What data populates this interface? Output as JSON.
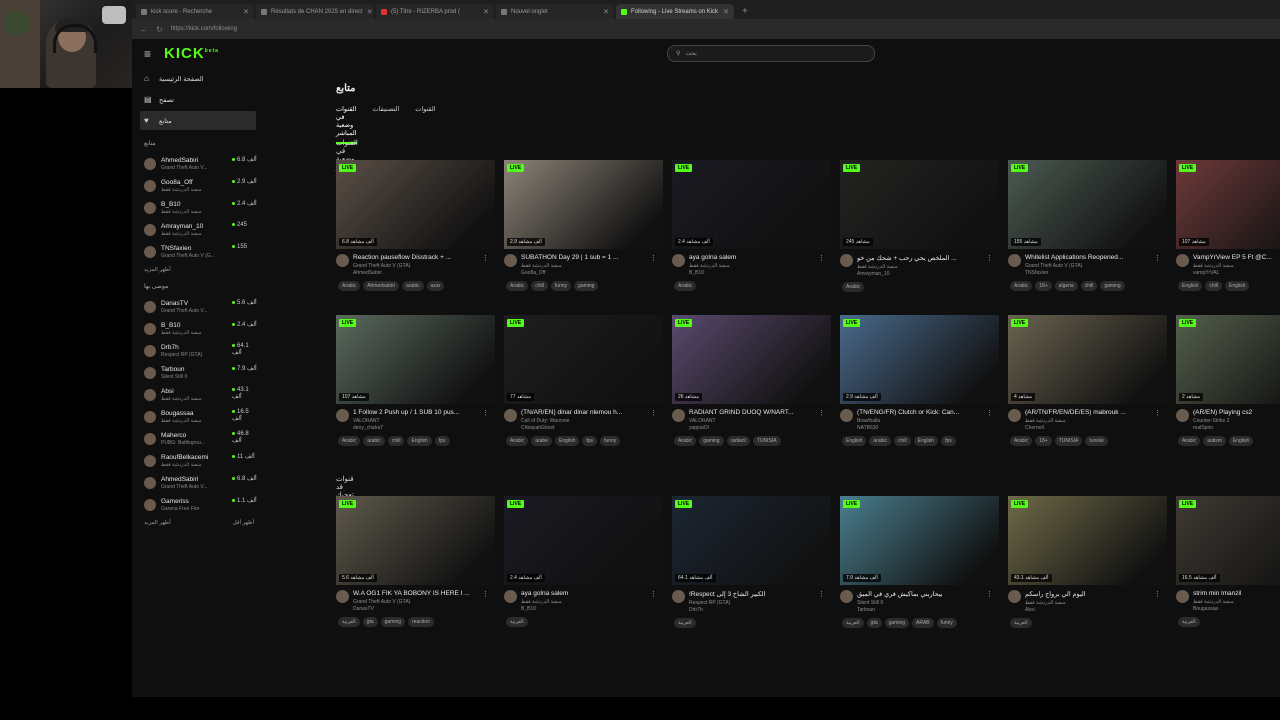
{
  "tabs": [
    {
      "label": "kick score - Recherche",
      "active": false
    },
    {
      "label": "Résultats de CHAN 2025 en direct",
      "active": false
    },
    {
      "label": "(5) Titre - RIZERBA prod (",
      "active": false
    },
    {
      "label": "Nouvel onglet",
      "active": false
    },
    {
      "label": "Following - Live Streams on Kick",
      "active": true
    }
  ],
  "address": {
    "url": "https://kick.com/following"
  },
  "header": {
    "logo": "KICK",
    "logo_sup": "beta",
    "search_placeholder": "بحث"
  },
  "sidebar": {
    "nav": [
      {
        "label": "الصفحة الرئيسية",
        "icon": "home-icon"
      },
      {
        "label": "تصفح",
        "icon": "browse-icon"
      },
      {
        "label": "متابع",
        "icon": "heart-icon"
      }
    ],
    "following_title": "متابع",
    "following": [
      {
        "name": "AhmedSabiri",
        "game": "Grand Theft Auto V...",
        "viewers": "6.8 ألف"
      },
      {
        "name": "Goo8a_Off",
        "game": "منصة الدردشة فقط",
        "viewers": "2.9 ألف"
      },
      {
        "name": "B_B10",
        "game": "منصة الدردشة فقط",
        "viewers": "2.4 ألف"
      },
      {
        "name": "Amrayman_10",
        "game": "منصة الدردشة فقط",
        "viewers": "245"
      },
      {
        "name": "TNSfaxien",
        "game": "Grand Theft Auto V (G...",
        "viewers": "155"
      }
    ],
    "show_more": "أظهر المزيد",
    "recommended_title": "موصى بها",
    "recommended": [
      {
        "name": "DanasTV",
        "game": "Grand Theft Auto V...",
        "viewers": "5.6 ألف"
      },
      {
        "name": "B_B10",
        "game": "منصة الدردشة فقط",
        "viewers": "2.4 ألف"
      },
      {
        "name": "Drb7h",
        "game": "Respect RP (GTA)",
        "viewers": "64.1 ألف"
      },
      {
        "name": "Tarboun",
        "game": "Silent Still II",
        "viewers": "7.9 ألف"
      },
      {
        "name": "Absi",
        "game": "منصة الدردشة فقط",
        "viewers": "43.1 ألف"
      },
      {
        "name": "Bougassaa",
        "game": "منصة الدردشة فقط",
        "viewers": "16.5 ألف"
      },
      {
        "name": "Maherco",
        "game": "PUBG: Battlegrou...",
        "viewers": "46.8 ألف"
      },
      {
        "name": "RaoufBelkacemi",
        "game": "منصة الدردشة فقط",
        "viewers": "11 ألف"
      },
      {
        "name": "AhmedSabiri",
        "game": "Grand Theft Auto V...",
        "viewers": "6.8 ألف"
      },
      {
        "name": "Gameriss",
        "game": "Garena Free Fire",
        "viewers": "1.1 ألف"
      }
    ],
    "show_more2": "أظهر المزيد",
    "show_less": "أظهر أقل"
  },
  "main": {
    "title": "متابع",
    "tabs": [
      {
        "label": "القنوات في وضعية المباشر",
        "active": true
      },
      {
        "label": "التصنيفات",
        "active": false
      },
      {
        "label": "القنوات",
        "active": false
      }
    ],
    "section_live": "القنوات في وضعية المباشر",
    "section_rec": "قنوات قد تعجبك"
  },
  "cards_row1": [
    {
      "title": "Reaction pauseflow Disstrack + ...",
      "game": "Grand Theft Auto V (GTA)",
      "channel": "AhmedSabiri",
      "views": "6.8 ألف مشاهد",
      "tags": [
        "Arabic",
        "Ahmedsabiri",
        "arabic",
        "azar"
      ],
      "color": "#5a4f46"
    },
    {
      "title": "SUBATHON Day 29 | 1 sub = 1 ...",
      "game": "منصة الدردشة فقط",
      "channel": "Goo8a_Off",
      "views": "2.9 ألف مشاهد",
      "tags": [
        "Arabic",
        "chill",
        "funny",
        "gaming"
      ],
      "color": "#8d8478"
    },
    {
      "title": "aya golna salem",
      "game": "منصة الدردشة فقط",
      "channel": "B_B10",
      "views": "2.4 ألف مشاهد",
      "tags": [
        "Arabic"
      ],
      "color": "#1a1a22"
    },
    {
      "title": "الملخص يحي رحب + شحك من خو ...",
      "game": "منصة الدردشة فقط",
      "channel": "Amrayman_10",
      "views": "245 مشاهد",
      "tags": [
        "Arabic"
      ],
      "color": "#222220"
    },
    {
      "title": "Whitelist Applications Reopened...",
      "game": "Grand Theft Auto V (GTA)",
      "channel": "TNSfaxien",
      "views": "155 مشاهد",
      "tags": [
        "Arabic",
        "18+",
        "algeria",
        "chill",
        "gaming"
      ],
      "color": "#4c5a52"
    },
    {
      "title": "VampYrView EP 5 Ft @C...",
      "game": "منصة الدردشة فقط",
      "channel": "vampYrVAL",
      "views": "107 مشاهد",
      "tags": [
        "English",
        "chill",
        "English"
      ],
      "color": "#6d3a3a"
    }
  ],
  "cards_row2": [
    {
      "title": "1 Follow 2 Push up / 1 SUB 10 pus...",
      "game": "VALORANT",
      "channel": "deny_chaha7",
      "views": "107 مشاهد",
      "tags": [
        "Arabic",
        "arabic",
        "chill",
        "English",
        "fps"
      ],
      "color": "#5b6a5e"
    },
    {
      "title": "(TN/AR/EN) dinar dinar nlemou h...",
      "game": "Call of Duty: Warzone",
      "channel": "ChbayahGhost",
      "views": "77 مشاهد",
      "tags": [
        "Arabic",
        "arabe",
        "English",
        "fps",
        "funny"
      ],
      "color": "#1e1e1e"
    },
    {
      "title": "RADIANT GRIND DUOQ W/NART...",
      "game": "VALORANT",
      "channel": "yappaiOl",
      "views": "26 مشاهد",
      "tags": [
        "Arabic",
        "gaming",
        "radiant",
        "TUNISIA"
      ],
      "color": "#5b4a6e"
    },
    {
      "title": "(TN/ENG/FR) Clutch or Kick: Can...",
      "game": "Brawlhalla",
      "channel": "NATB630",
      "views": "2.9 ألف مشاهد",
      "tags": [
        "English",
        "arabic",
        "chill",
        "English",
        "fps"
      ],
      "color": "#4a6a8c"
    },
    {
      "title": "(AR/TN/FR/EN/DE/ES) mabrouk ...",
      "game": "منصة الدردشة فقط",
      "channel": "ChernoX",
      "views": "4 مشاهد",
      "tags": [
        "Arabic",
        "18+",
        "TUNISIA",
        "tunisie"
      ],
      "color": "#6b6350"
    },
    {
      "title": "(AR/EN) Playing cs2",
      "game": "Counter-Strike 2",
      "channel": "realSpiro",
      "views": "2 مشاهد",
      "tags": [
        "Arabic",
        "autism",
        "English"
      ],
      "color": "#55604c"
    }
  ],
  "cards_row3": [
    {
      "title": "W.A OG1 FIK YA BOBONY IS HERE I ...",
      "game": "Grand Theft Auto V (GTA)",
      "channel": "DanasTV",
      "views": "5.6 ألف مشاهد",
      "tags": [
        "العربية",
        "gta",
        "gaming",
        "reaction"
      ],
      "color": "#5f5a4c"
    },
    {
      "title": "aya golna salem",
      "game": "منصة الدردشة فقط",
      "channel": "B_B10",
      "views": "2.4 ألف مشاهد",
      "tags": [
        "العربية"
      ],
      "color": "#1a1a22"
    },
    {
      "title": "!Respect الكبير الشاخ 3 إلى",
      "game": "Respect RP (GTA)",
      "channel": "Drb7h",
      "views": "64.1 ألف مشاهد",
      "tags": [
        "العربية"
      ],
      "color": "#1c2633"
    },
    {
      "title": "بيحاربني بماكيش فري في المبق",
      "game": "Silent Still II",
      "channel": "Tarboun",
      "views": "7.9 ألف مشاهد",
      "tags": [
        "العربية",
        "gta",
        "gaming",
        "ARAB",
        "funny"
      ],
      "color": "#4a7f8f"
    },
    {
      "title": "اليوم الي برواج راسكم",
      "game": "منصة الدردشة فقط",
      "channel": "Absi",
      "views": "43.1 ألف مشاهد",
      "tags": [
        "العربية"
      ],
      "color": "#6f6a48"
    },
    {
      "title": "strim min lmanzil",
      "game": "منصة الدردشة فقط",
      "channel": "Bougassaa",
      "views": "16.5 ألف مشاهد",
      "tags": [
        "العربية"
      ],
      "color": "#3f3a33"
    }
  ],
  "live_label": "LIVE",
  "colors": {
    "accent": "#53fc18",
    "bg": "#0f0f10"
  }
}
